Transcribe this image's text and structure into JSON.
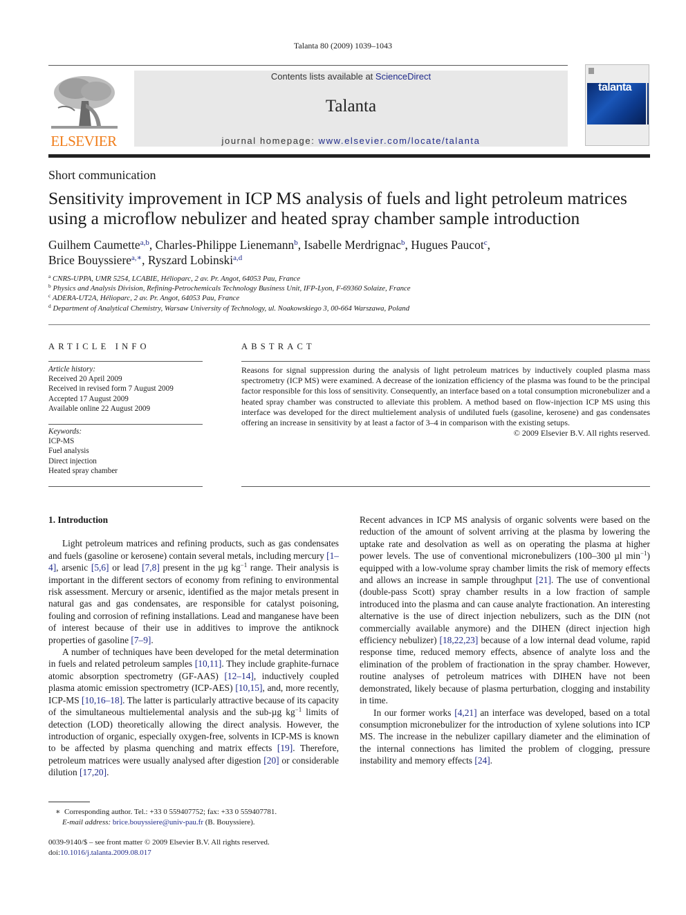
{
  "header": {
    "running_head": "Talanta 80 (2009) 1039–1043",
    "contents_prefix": "Contents lists available at ",
    "contents_link": "ScienceDirect",
    "journal_title": "Talanta",
    "homepage_prefix": "journal homepage: ",
    "homepage_link": "www.elsevier.com/locate/talanta",
    "publisher_logo": "ELSEVIER",
    "cover_title": "talanta",
    "brand_color": "#f07d1a",
    "link_color": "#1f2a8a"
  },
  "article": {
    "type": "Short communication",
    "title": "Sensitivity improvement in ICP MS analysis of fuels and light petroleum matrices using a microflow nebulizer and heated spray chamber sample introduction",
    "authors": [
      {
        "name": "Guilhem Caumette",
        "aff": "a,b",
        "sep": ", "
      },
      {
        "name": "Charles-Philippe Lienemann",
        "aff": "b",
        "sep": ", "
      },
      {
        "name": "Isabelle Merdrignac",
        "aff": "b",
        "sep": ", "
      },
      {
        "name": "Hugues Paucot",
        "aff": "c",
        "sep": ","
      },
      {
        "name": "Brice Bouyssiere",
        "aff": "a,∗",
        "sep": ", "
      },
      {
        "name": "Ryszard Lobinski",
        "aff": "a,d",
        "sep": ""
      }
    ],
    "affiliations": [
      {
        "key": "a",
        "text": "CNRS-UPPA, UMR 5254, LCABIE, Hélioparc, 2 av. Pr. Angot, 64053 Pau, France"
      },
      {
        "key": "b",
        "text": "Physics and Analysis Division, Refining-Petrochemicals Technology Business Unit, IFP-Lyon, F-69360 Solaize, France"
      },
      {
        "key": "c",
        "text": "ADERA-UT2A, Hélioparc, 2 av. Pr. Angot, 64053 Pau, France"
      },
      {
        "key": "d",
        "text": "Department of Analytical Chemistry, Warsaw University of Technology, ul. Noakowskiego 3, 00-664 Warszawa, Poland"
      }
    ]
  },
  "article_info": {
    "heading": "ARTICLE INFO",
    "history_label": "Article history:",
    "history": [
      "Received 20 April 2009",
      "Received in revised form 7 August 2009",
      "Accepted 17 August 2009",
      "Available online 22 August 2009"
    ],
    "keywords_label": "Keywords:",
    "keywords": [
      "ICP-MS",
      "Fuel analysis",
      "Direct injection",
      "Heated spray chamber"
    ]
  },
  "abstract": {
    "heading": "ABSTRACT",
    "text": "Reasons for signal suppression during the analysis of light petroleum matrices by inductively coupled plasma mass spectrometry (ICP MS) were examined. A decrease of the ionization efficiency of the plasma was found to be the principal factor responsible for this loss of sensitivity. Consequently, an interface based on a total consumption micronebulizer and a heated spray chamber was constructed to alleviate this problem. A method based on flow-injection ICP MS using this interface was developed for the direct multielement analysis of undiluted fuels (gasoline, kerosene) and gas condensates offering an increase in sensitivity by at least a factor of 3–4 in comparison with the existing setups.",
    "copyright": "© 2009 Elsevier B.V. All rights reserved."
  },
  "body": {
    "section_heading": "1.  Introduction",
    "paragraphs": [
      {
        "indent": true,
        "segments": [
          {
            "t": "Light petroleum matrices and refining products, such as gas condensates and fuels (gasoline or kerosene) contain several metals, including mercury "
          },
          {
            "t": "[1–4]",
            "ref": true
          },
          {
            "t": ", arsenic "
          },
          {
            "t": "[5,6]",
            "ref": true
          },
          {
            "t": " or lead "
          },
          {
            "t": "[7,8]",
            "ref": true
          },
          {
            "t": " present in the µg kg"
          },
          {
            "t": "−1",
            "sup": true
          },
          {
            "t": " range. Their analysis is important in the different sectors of economy from refining to environmental risk assessment. Mercury or arsenic, identified as the major metals present in natural gas and gas condensates, are responsible for catalyst poisoning, fouling and corrosion of refining installations. Lead and manganese have been of interest because of their use in additives to improve the antiknock properties of gasoline "
          },
          {
            "t": "[7–9]",
            "ref": true
          },
          {
            "t": "."
          }
        ]
      },
      {
        "indent": true,
        "segments": [
          {
            "t": "A number of techniques have been developed for the metal determination in fuels and related petroleum samples "
          },
          {
            "t": "[10,11]",
            "ref": true
          },
          {
            "t": ". They include graphite-furnace atomic absorption spectrometry (GF-AAS) "
          },
          {
            "t": "[12–14]",
            "ref": true
          },
          {
            "t": ", inductively coupled plasma atomic emission spectrometry (ICP-AES) "
          },
          {
            "t": "[10,15]",
            "ref": true
          },
          {
            "t": ", and, more recently, ICP-MS "
          },
          {
            "t": "[10,16–18]",
            "ref": true
          },
          {
            "t": ". The latter is particularly attractive because of its capacity of the simultaneous multielemental analysis and the sub-µg kg"
          },
          {
            "t": "−1",
            "sup": true
          },
          {
            "t": " limits of detection (LOD) theoretically allowing the direct analysis. However, the introduction of organic, especially oxygen-free, solvents in ICP-MS is known to be affected by plasma quenching and matrix effects "
          },
          {
            "t": "[19]",
            "ref": true
          },
          {
            "t": ". Therefore, petroleum matrices were usually analysed after digestion "
          },
          {
            "t": "[20]",
            "ref": true
          },
          {
            "t": " or considerable dilution "
          },
          {
            "t": "[17,20]",
            "ref": true
          },
          {
            "t": "."
          }
        ]
      },
      {
        "indent": true,
        "segments": [
          {
            "t": "Recent advances in ICP MS analysis of organic solvents were based on the reduction of the amount of solvent arriving at the plasma by lowering the uptake rate and desolvation as well as on operating the plasma at higher power levels. The use of conventional micronebulizers (100–300 µl min"
          },
          {
            "t": "−1",
            "sup": true
          },
          {
            "t": ") equipped with a low-volume spray chamber limits the risk of memory effects and allows an increase in sample throughput "
          },
          {
            "t": "[21]",
            "ref": true
          },
          {
            "t": ". The use of conventional (double-pass Scott) spray chamber results in a low fraction of sample introduced into the plasma and can cause analyte fractionation. An interesting alternative is the use of direct injection nebulizers, such as the DIN (not commercially available anymore) and the DIHEN (direct injection high efficiency nebulizer) "
          },
          {
            "t": "[18,22,23]",
            "ref": true
          },
          {
            "t": " because of a low internal dead volume, rapid response time, reduced memory effects, absence of analyte loss and the elimination of the problem of fractionation in the spray chamber. However, routine analyses of petroleum matrices with DIHEN have not been demonstrated, likely because of plasma perturbation, clogging and instability in time."
          }
        ]
      },
      {
        "indent": true,
        "segments": [
          {
            "t": "In our former works "
          },
          {
            "t": "[4,21]",
            "ref": true
          },
          {
            "t": " an interface was developed, based on a total consumption micronebulizer for the introduction of xylene solutions into ICP MS. The increase in the nebulizer capillary diameter and the elimination of the internal connections has limited the problem of clogging, pressure instability and memory effects "
          },
          {
            "t": "[24]",
            "ref": true
          },
          {
            "t": "."
          }
        ]
      }
    ]
  },
  "footnotes": {
    "corresponding_marker": "∗",
    "corresponding": "Corresponding author. Tel.: +33 0 559407752; fax: +33 0 559407781.",
    "email_label": "E-mail address:",
    "email": "brice.bouyssiere@univ-pau.fr",
    "email_suffix": " (B. Bouyssiere).",
    "front_matter": "0039-9140/$ – see front matter © 2009 Elsevier B.V. All rights reserved.",
    "doi_prefix": "doi:",
    "doi": "10.1016/j.talanta.2009.08.017"
  }
}
